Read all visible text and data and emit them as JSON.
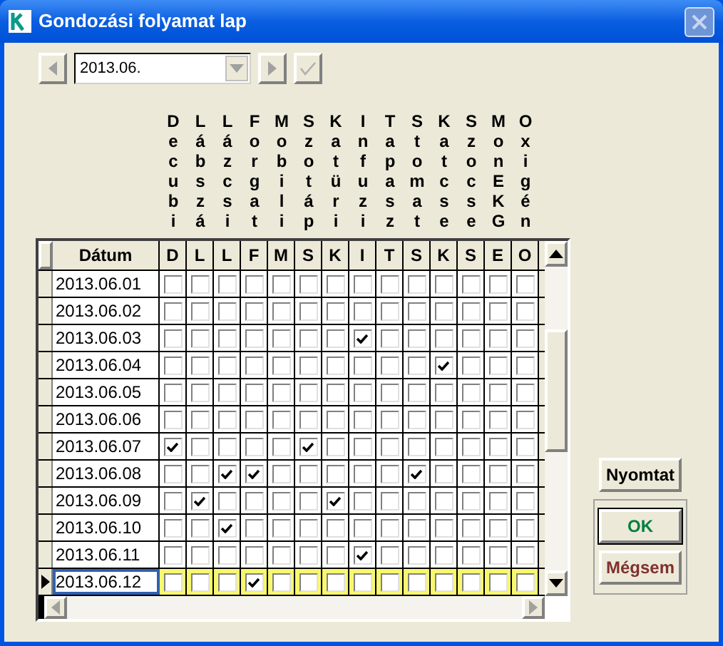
{
  "window": {
    "title": "Gondozási folyamat lap"
  },
  "period": {
    "value": "2013.06."
  },
  "columns": [
    {
      "full": "Decubi",
      "short": "D"
    },
    {
      "full": "Lábszá",
      "short": "L"
    },
    {
      "full": "Lázcsi",
      "short": "L"
    },
    {
      "full": "Forgat",
      "short": "F"
    },
    {
      "full": "Mobili",
      "short": "M"
    },
    {
      "full": "Szotáp",
      "short": "S"
    },
    {
      "full": "Katüri",
      "short": "K"
    },
    {
      "full": "Infuzi",
      "short": "I"
    },
    {
      "full": "Tapasz",
      "short": "T"
    },
    {
      "full": "Stomat",
      "short": "S"
    },
    {
      "full": "Katcse",
      "short": "K"
    },
    {
      "full": "Szocse",
      "short": "S"
    },
    {
      "full": "MonEKG",
      "short": "E"
    },
    {
      "full": "Oxigén",
      "short": "O"
    }
  ],
  "table": {
    "date_header": "Dátum",
    "rows": [
      {
        "date": "2013.06.01",
        "selected": false,
        "checks": [
          false,
          false,
          false,
          false,
          false,
          false,
          false,
          false,
          false,
          false,
          false,
          false,
          false,
          false
        ]
      },
      {
        "date": "2013.06.02",
        "selected": false,
        "checks": [
          false,
          false,
          false,
          false,
          false,
          false,
          false,
          false,
          false,
          false,
          false,
          false,
          false,
          false
        ]
      },
      {
        "date": "2013.06.03",
        "selected": false,
        "checks": [
          false,
          false,
          false,
          false,
          false,
          false,
          false,
          true,
          false,
          false,
          false,
          false,
          false,
          false
        ]
      },
      {
        "date": "2013.06.04",
        "selected": false,
        "checks": [
          false,
          false,
          false,
          false,
          false,
          false,
          false,
          false,
          false,
          false,
          true,
          false,
          false,
          false
        ]
      },
      {
        "date": "2013.06.05",
        "selected": false,
        "checks": [
          false,
          false,
          false,
          false,
          false,
          false,
          false,
          false,
          false,
          false,
          false,
          false,
          false,
          false
        ]
      },
      {
        "date": "2013.06.06",
        "selected": false,
        "checks": [
          false,
          false,
          false,
          false,
          false,
          false,
          false,
          false,
          false,
          false,
          false,
          false,
          false,
          false
        ]
      },
      {
        "date": "2013.06.07",
        "selected": false,
        "checks": [
          true,
          false,
          false,
          false,
          false,
          true,
          false,
          false,
          false,
          false,
          false,
          false,
          false,
          false
        ]
      },
      {
        "date": "2013.06.08",
        "selected": false,
        "checks": [
          false,
          false,
          true,
          true,
          false,
          false,
          false,
          false,
          false,
          true,
          false,
          false,
          false,
          false
        ]
      },
      {
        "date": "2013.06.09",
        "selected": false,
        "checks": [
          false,
          true,
          false,
          false,
          false,
          false,
          true,
          false,
          false,
          false,
          false,
          false,
          false,
          false
        ]
      },
      {
        "date": "2013.06.10",
        "selected": false,
        "checks": [
          false,
          false,
          true,
          false,
          false,
          false,
          false,
          false,
          false,
          false,
          false,
          false,
          false,
          false
        ]
      },
      {
        "date": "2013.06.11",
        "selected": false,
        "checks": [
          false,
          false,
          false,
          false,
          false,
          false,
          false,
          true,
          false,
          false,
          false,
          false,
          false,
          false
        ]
      },
      {
        "date": "2013.06.12",
        "selected": true,
        "checks": [
          false,
          false,
          false,
          true,
          false,
          false,
          false,
          false,
          false,
          false,
          false,
          false,
          false,
          false
        ]
      }
    ]
  },
  "buttons": [
    {
      "kind": "print",
      "label": "Nyomtat"
    },
    {
      "kind": "ok",
      "label": "OK"
    },
    {
      "kind": "cancel",
      "label": "Mégsem"
    }
  ]
}
